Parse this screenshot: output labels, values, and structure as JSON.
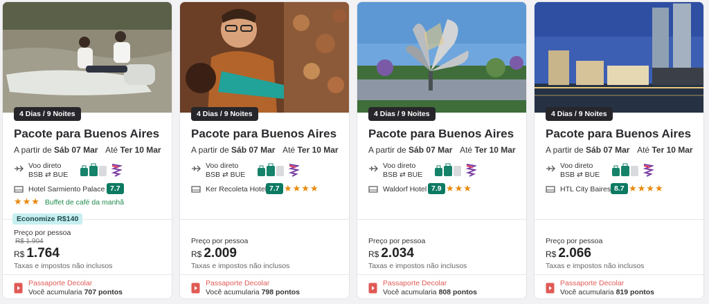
{
  "cards": [
    {
      "duration": "4 Dias / 9 Noites",
      "title": "Pacote para Buenos Aires",
      "from_label": "A partir de",
      "start_date": "Sáb 07 Mar",
      "until_label": "Até",
      "end_date": "Ter 10 Mar",
      "flight_type": "Voo direto",
      "route_from": "BSB",
      "route_to": "BUE",
      "hotel_name": "Hotel Sarmiento Palace",
      "hotel_score": "7.7",
      "hotel_stars": "★★★",
      "amenity": "Buffet de café da manhã",
      "savings": "Economize R$140",
      "price_label": "Preço por pessoa",
      "old_price": "R$ 1.904",
      "currency": "R$",
      "price": "1.764",
      "taxes": "Taxas e impostos não inclusos",
      "passport_title": "Passaporte Decolar",
      "passport_text": "Você acumularia",
      "points": "707 pontos"
    },
    {
      "duration": "4 Dias / 9 Noites",
      "title": "Pacote para Buenos Aires",
      "from_label": "A partir de",
      "start_date": "Sáb 07 Mar",
      "until_label": "Até",
      "end_date": "Ter 10 Mar",
      "flight_type": "Voo direto",
      "route_from": "BSB",
      "route_to": "BUE",
      "hotel_name": "Ker Recoleta Hotel",
      "hotel_score": "7.7",
      "hotel_stars": "★★★★",
      "price_label": "Preço por pessoa",
      "currency": "R$",
      "price": "2.009",
      "taxes": "Taxas e impostos não inclusos",
      "passport_title": "Passaporte Decolar",
      "passport_text": "Você acumularia",
      "points": "798 pontos"
    },
    {
      "duration": "4 Dias / 9 Noites",
      "title": "Pacote para Buenos Aires",
      "from_label": "A partir de",
      "start_date": "Sáb 07 Mar",
      "until_label": "Até",
      "end_date": "Ter 10 Mar",
      "flight_type": "Voo direto",
      "route_from": "BSB",
      "route_to": "BUE",
      "hotel_name": "Waldorf Hotel",
      "hotel_score": "7.9",
      "hotel_stars": "★★★",
      "price_label": "Preço por pessoa",
      "currency": "R$",
      "price": "2.034",
      "taxes": "Taxas e impostos não inclusos",
      "passport_title": "Passaporte Decolar",
      "passport_text": "Você acumularia",
      "points": "808 pontos"
    },
    {
      "duration": "4 Dias / 9 Noites",
      "title": "Pacote para Buenos Aires",
      "from_label": "A partir de",
      "start_date": "Sáb 07 Mar",
      "until_label": "Até",
      "end_date": "Ter 10 Mar",
      "flight_type": "Voo direto",
      "route_from": "BSB",
      "route_to": "BUE",
      "hotel_name": "HTL City Baires",
      "hotel_score": "8.7",
      "hotel_stars": "★★★★",
      "price_label": "Preço por pessoa",
      "currency": "R$",
      "price": "2.066",
      "taxes": "Taxas e impostos não inclusos",
      "passport_title": "Passaporte Decolar",
      "passport_text": "Você acumularia",
      "points": "819 pontos"
    }
  ],
  "colors": {
    "score_badge": "#0c7a63",
    "stars": "#e8890c",
    "savings_badge": "#c7eef0",
    "passport": "#e05a55",
    "amenity": "#1f8a4c"
  },
  "icons": {
    "flight": "plane-icon",
    "route": "arrows-exchange-icon",
    "baggage": "luggage-icon",
    "airline": "airline-logo-icon",
    "hotel": "bed-icon",
    "passport": "passport-icon"
  }
}
